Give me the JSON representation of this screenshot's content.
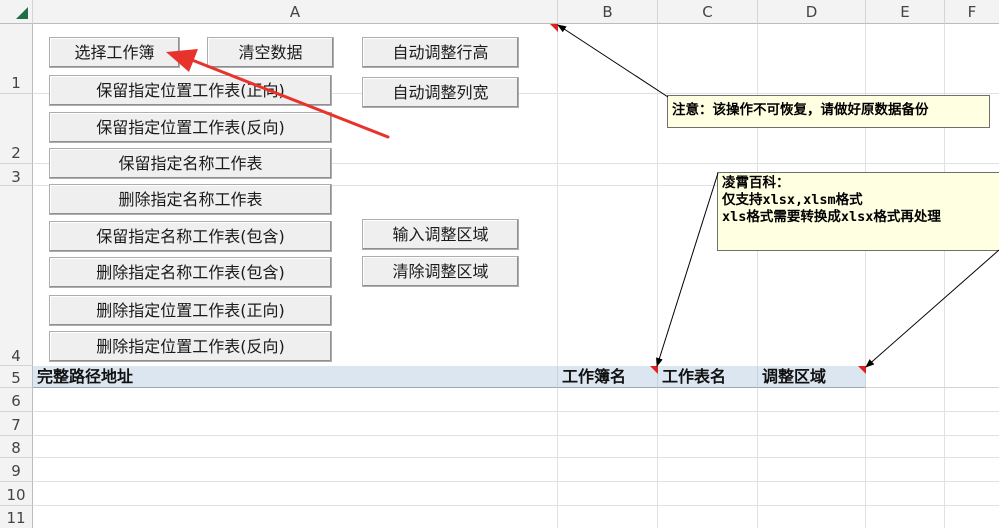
{
  "columns": [
    "A",
    "B",
    "C",
    "D",
    "E",
    "F"
  ],
  "rows": [
    "1",
    "2",
    "3",
    "4",
    "5",
    "6",
    "7",
    "8",
    "9",
    "10",
    "11"
  ],
  "buttons": {
    "select_workbook": "选择工作簿",
    "clear_data": "清空数据",
    "auto_row_height": "自动调整行高",
    "keep_position_forward": "保留指定位置工作表(正向)",
    "auto_col_width": "自动调整列宽",
    "keep_position_reverse": "保留指定位置工作表(反向)",
    "keep_named": "保留指定名称工作表",
    "delete_named": "删除指定名称工作表",
    "keep_named_contains": "保留指定名称工作表(包含)",
    "input_region": "输入调整区域",
    "delete_named_contains": "删除指定名称工作表(包含)",
    "clear_region": "清除调整区域",
    "delete_position_forward": "删除指定位置工作表(正向)",
    "delete_position_reverse": "删除指定位置工作表(反向)"
  },
  "notes": {
    "warning": "注意：该操作不可恢复，请做好原数据备份",
    "info": "凌霄百科：\n仅支持xlsx,xlsm格式\nxls格式需要转换成xlsx格式再处理"
  },
  "header_row": {
    "full_path": "完整路径地址",
    "workbook_name": "工作簿名",
    "worksheet_name": "工作表名",
    "adjust_region": "调整区域"
  },
  "colors": {
    "header_fill": "#dce6f1",
    "note_fill": "#ffffe1",
    "arrow": "#e8332d",
    "comment_marker": "#e02020"
  }
}
